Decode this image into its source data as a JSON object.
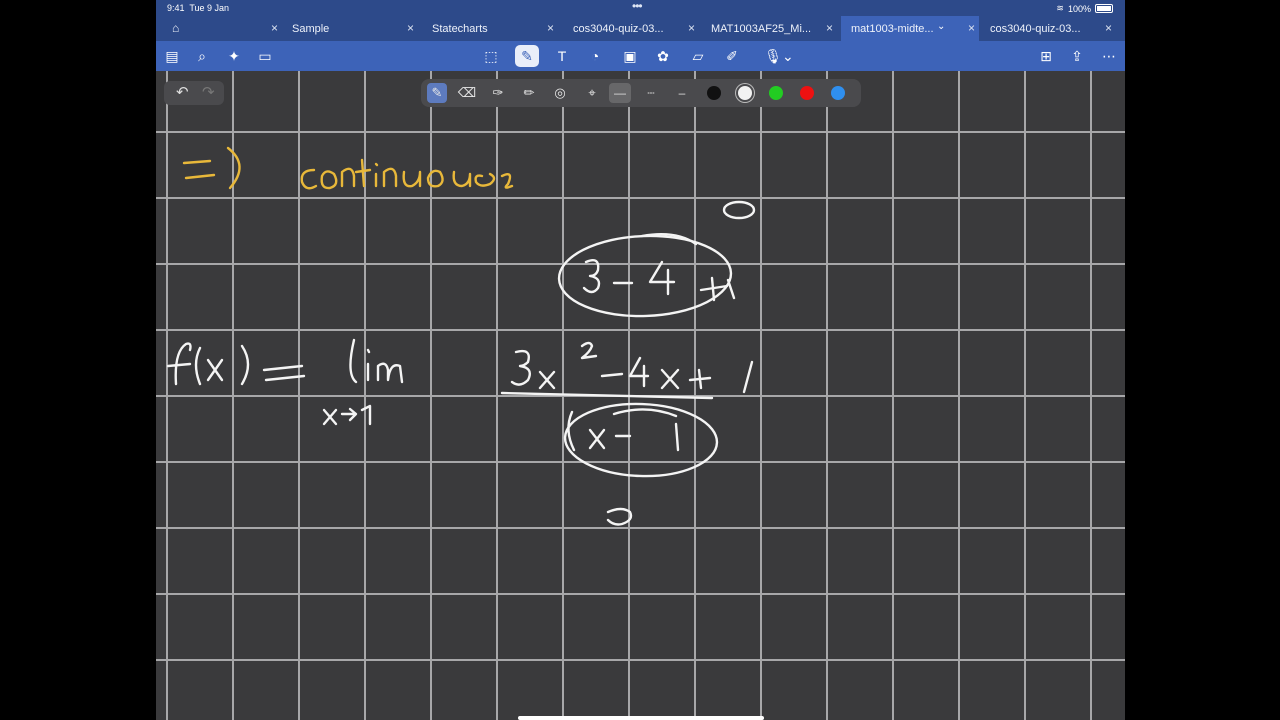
{
  "status_bar": {
    "time": "9:41",
    "date": "Tue 9 Jan",
    "battery": "100%"
  },
  "tabs": [
    {
      "label": "",
      "icon": "home-icon",
      "active": false
    },
    {
      "label": "Sample",
      "active": false
    },
    {
      "label": "Statecharts",
      "active": false
    },
    {
      "label": "cos3040-quiz-03...",
      "active": false
    },
    {
      "label": "MAT1003AF25_Mi...",
      "active": false
    },
    {
      "label": "mat1003-midte...",
      "active": true
    },
    {
      "label": "cos3040-quiz-03...",
      "active": false
    }
  ],
  "toolbar": {
    "left_icons": [
      "sidebar-icon",
      "search-icon",
      "bookmark-add-icon",
      "document-outline-icon"
    ],
    "center_icons": [
      "lasso-select-icon",
      "pen-tool-icon",
      "text-box-icon",
      "shapes-icon",
      "image-icon",
      "elements-icon",
      "sticky-note-icon",
      "laser-pointer-icon",
      "audio-record-icon"
    ],
    "right_icons": [
      "add-page-icon",
      "share-icon",
      "more-icon"
    ]
  },
  "drawing_tools": {
    "tools": [
      "pen-icon",
      "eraser-icon",
      "highlighter-icon",
      "pencil-icon",
      "shape-icon",
      "lasso-icon"
    ],
    "line_styles": [
      "solid-line",
      "dashed-line",
      "thin-line"
    ],
    "colors": [
      "#111111",
      "#f2f2f2",
      "#22cc22",
      "#ee1111",
      "#2f8fef"
    ],
    "selected_color": "#f2f2f2"
  },
  "note": {
    "line1": "=) continuous",
    "expression": "f(x) = lim x→1 (3x² - 4x + 1)/(x - 1)",
    "numerator_eval": "3 - 4 + 1",
    "numerator_result": "0",
    "denominator_result": "0"
  },
  "colors": {
    "ink_yellow": "#e8b83a",
    "ink_white": "#f4f4f4",
    "grid": "#a7a7a9",
    "paper": "#3a3a3c",
    "tabbar": "#2d4a8a",
    "toolbar": "#3d63b8"
  }
}
